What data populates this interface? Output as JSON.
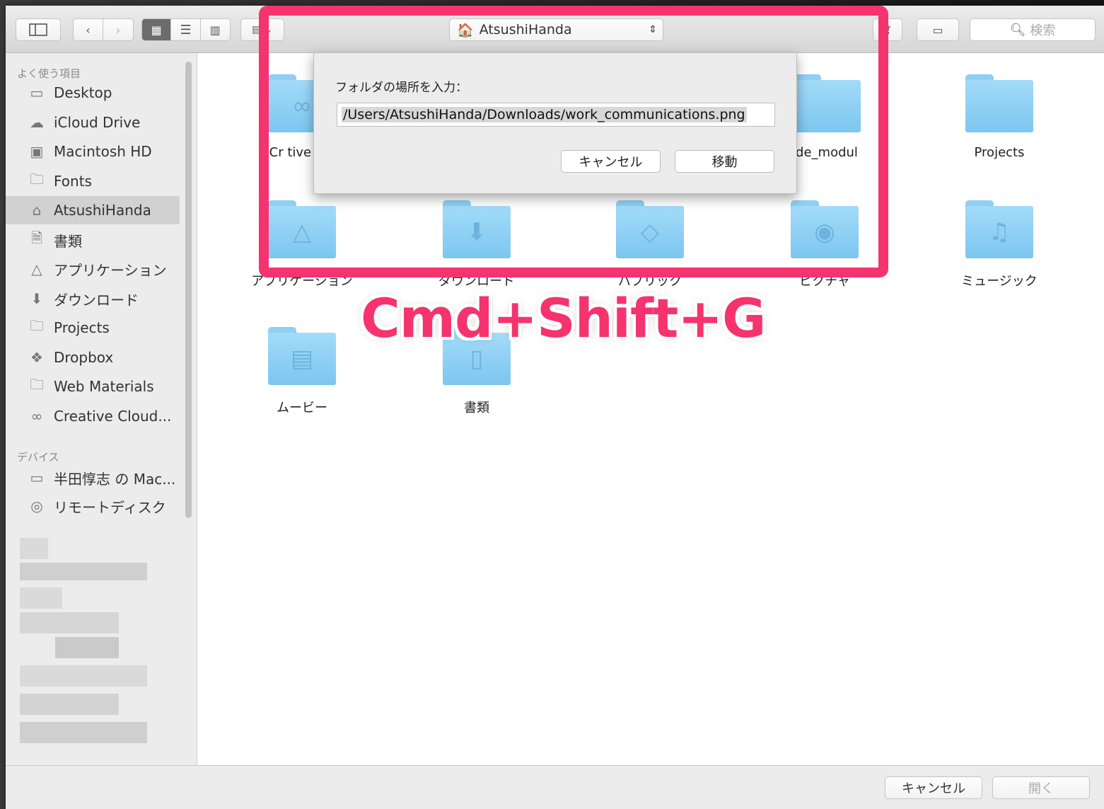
{
  "toolbar": {
    "path_popup": "AtsushiHanda",
    "search_placeholder": "検索"
  },
  "sidebar": {
    "favorites_header": "よく使う項目",
    "favorites": [
      {
        "label": "Desktop",
        "icon": "desktop-icon"
      },
      {
        "label": "iCloud Drive",
        "icon": "cloud-icon"
      },
      {
        "label": "Macintosh HD",
        "icon": "disk-icon"
      },
      {
        "label": "Fonts",
        "icon": "folder-icon"
      },
      {
        "label": "AtsushiHanda",
        "icon": "home-icon",
        "selected": true
      },
      {
        "label": "書類",
        "icon": "document-icon"
      },
      {
        "label": "アプリケーション",
        "icon": "applications-icon"
      },
      {
        "label": "ダウンロード",
        "icon": "download-icon"
      },
      {
        "label": "Projects",
        "icon": "folder-icon"
      },
      {
        "label": "Dropbox",
        "icon": "dropbox-icon"
      },
      {
        "label": "Web Materials",
        "icon": "folder-icon"
      },
      {
        "label": "Creative Cloud...",
        "icon": "creative-cloud-icon"
      }
    ],
    "devices_header": "デバイス",
    "devices": [
      {
        "label": "半田惇志 の Mac...",
        "icon": "laptop-icon"
      },
      {
        "label": "リモートディスク",
        "icon": "remote-disc-icon"
      }
    ]
  },
  "main": {
    "items": [
      {
        "label": "Cr  tive Clc",
        "icon": "creative-cloud-icon"
      },
      {
        "label": "de_modul",
        "icon": "folder-icon"
      },
      {
        "label": "Projects",
        "icon": "folder-icon"
      },
      {
        "label": "アプリケーション",
        "icon": "applications-icon"
      },
      {
        "label": "ダウンロード",
        "icon": "download-icon"
      },
      {
        "label": "パブリック",
        "icon": "public-icon"
      },
      {
        "label": "ピクチャ",
        "icon": "camera-icon"
      },
      {
        "label": "ミュージック",
        "icon": "music-icon"
      },
      {
        "label": "ムービー",
        "icon": "movie-icon"
      },
      {
        "label": "書類",
        "icon": "document-icon"
      }
    ]
  },
  "goto_sheet": {
    "label": "フォルダの場所を入力：",
    "value": "/Users/AtsushiHanda/Downloads/work_communications.png",
    "cancel": "キャンセル",
    "go": "移動"
  },
  "bottom_bar": {
    "cancel": "キャンセル",
    "open": "開く"
  },
  "annotation": {
    "text": "Cmd+Shift+G",
    "color": "#f5336e"
  }
}
